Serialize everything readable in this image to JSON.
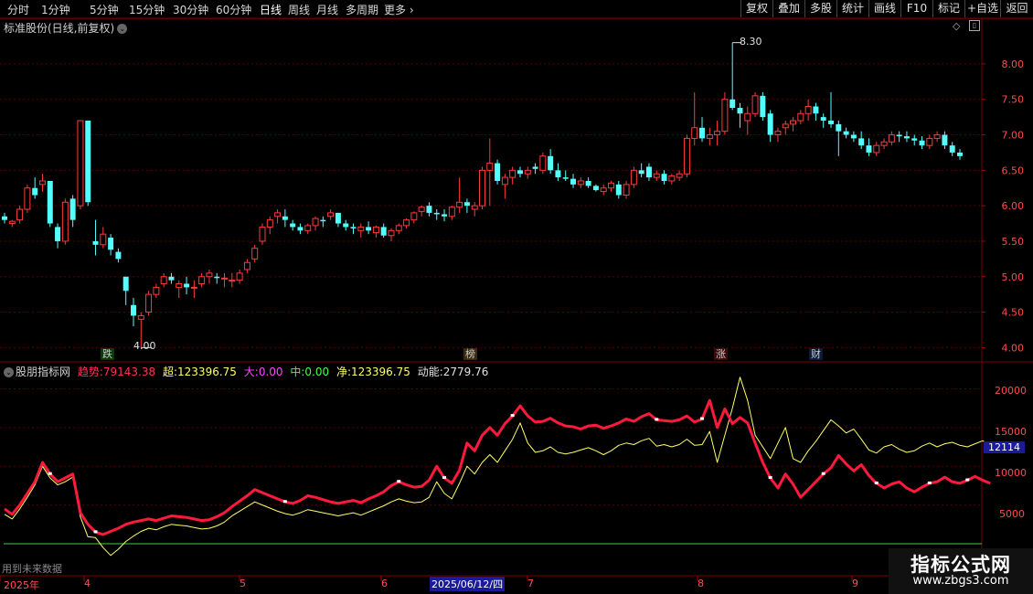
{
  "toolbar": {
    "periods": [
      "分时",
      "1分钟",
      "5分钟",
      "15分钟",
      "30分钟",
      "60分钟",
      "日线",
      "周线",
      "月线",
      "多周期",
      "更多"
    ],
    "active_period": "日线",
    "right_buttons": [
      "复权",
      "叠加",
      "多股",
      "统计",
      "画线",
      "F10",
      "标记",
      "+自选",
      "返回"
    ]
  },
  "main_chart": {
    "title": "标准股份(日线,前复权)",
    "price_axis": [
      "8.00",
      "7.50",
      "7.00",
      "6.50",
      "6.00",
      "5.50",
      "5.00",
      "4.50",
      "4.00"
    ],
    "high_label": "8.30",
    "low_label": "4.00",
    "markers": [
      {
        "text": "跌",
        "color": "#33cc33"
      },
      {
        "text": "榜",
        "color": "#e0a060"
      },
      {
        "text": "涨",
        "color": "#ff4040"
      },
      {
        "text": "财",
        "color": "#4aa8ff"
      }
    ],
    "colors": {
      "up": "#ff3b3b",
      "down": "#54ffff",
      "grid": "#550000"
    }
  },
  "indicator": {
    "name": "股朋指标网",
    "trend_label": "趋势:",
    "trend_value": "79143.38",
    "super_label": "超:",
    "super_value": "123396.75",
    "big_label": "大:",
    "big_value": "0.00",
    "mid_label": "中:",
    "mid_value": "0.00",
    "net_label": "净:",
    "net_value": "123396.75",
    "power_label": "动能:",
    "power_value": "2779.76",
    "axis": [
      "20000",
      "15000",
      "10000",
      "5000"
    ],
    "current_tag": "12114",
    "footer_text": "用到未来数据"
  },
  "time_axis": {
    "labels": [
      "2025年",
      "4",
      "5",
      "6",
      "2025/06/12/四",
      "7",
      "8",
      "9"
    ]
  },
  "watermark": {
    "title": "指标公式网",
    "url": "www.zbgs3.com"
  },
  "chart_data": {
    "type": "candlestick",
    "ohlc": [
      [
        5.85,
        5.9,
        5.75,
        5.8
      ],
      [
        5.75,
        5.8,
        5.7,
        5.78
      ],
      [
        5.8,
        6.0,
        5.75,
        5.95
      ],
      [
        5.95,
        6.3,
        5.9,
        6.25
      ],
      [
        6.25,
        6.4,
        6.1,
        6.15
      ],
      [
        6.3,
        6.45,
        6.2,
        6.35
      ],
      [
        6.35,
        6.35,
        5.7,
        5.75
      ],
      [
        5.7,
        5.75,
        5.4,
        5.5
      ],
      [
        5.5,
        6.1,
        5.45,
        6.05
      ],
      [
        6.1,
        6.15,
        5.7,
        5.8
      ],
      [
        6.0,
        7.2,
        5.95,
        7.2
      ],
      [
        7.2,
        7.2,
        6.0,
        6.05
      ],
      [
        5.5,
        5.8,
        5.3,
        5.45
      ],
      [
        5.45,
        5.7,
        5.4,
        5.6
      ],
      [
        5.55,
        5.6,
        5.3,
        5.38
      ],
      [
        5.35,
        5.4,
        5.2,
        5.25
      ],
      [
        5.0,
        5.0,
        4.6,
        4.8
      ],
      [
        4.6,
        4.7,
        4.3,
        4.45
      ],
      [
        4.4,
        4.5,
        4.0,
        4.45
      ],
      [
        4.5,
        4.8,
        4.45,
        4.75
      ],
      [
        4.75,
        4.9,
        4.7,
        4.85
      ],
      [
        4.9,
        5.05,
        4.85,
        5.0
      ],
      [
        5.0,
        5.05,
        4.9,
        4.95
      ],
      [
        4.85,
        4.95,
        4.7,
        4.9
      ],
      [
        4.9,
        5.0,
        4.75,
        4.85
      ],
      [
        4.85,
        4.95,
        4.7,
        4.85
      ],
      [
        4.9,
        5.05,
        4.85,
        5.0
      ],
      [
        5.0,
        5.1,
        4.9,
        5.05
      ],
      [
        5.0,
        5.05,
        4.9,
        4.98
      ],
      [
        4.98,
        5.05,
        4.85,
        4.98
      ],
      [
        4.95,
        5.05,
        4.85,
        4.95
      ],
      [
        4.95,
        5.1,
        4.9,
        5.05
      ],
      [
        5.1,
        5.25,
        5.05,
        5.2
      ],
      [
        5.25,
        5.45,
        5.2,
        5.4
      ],
      [
        5.5,
        5.75,
        5.45,
        5.7
      ],
      [
        5.7,
        5.85,
        5.6,
        5.8
      ],
      [
        5.85,
        5.95,
        5.75,
        5.9
      ],
      [
        5.85,
        5.95,
        5.7,
        5.8
      ],
      [
        5.75,
        5.8,
        5.65,
        5.7
      ],
      [
        5.7,
        5.75,
        5.6,
        5.65
      ],
      [
        5.65,
        5.75,
        5.6,
        5.72
      ],
      [
        5.72,
        5.85,
        5.65,
        5.82
      ],
      [
        5.8,
        5.85,
        5.7,
        5.78
      ],
      [
        5.85,
        5.95,
        5.8,
        5.9
      ],
      [
        5.9,
        5.9,
        5.7,
        5.75
      ],
      [
        5.75,
        5.8,
        5.65,
        5.7
      ],
      [
        5.7,
        5.75,
        5.6,
        5.68
      ],
      [
        5.65,
        5.75,
        5.55,
        5.7
      ],
      [
        5.7,
        5.78,
        5.6,
        5.65
      ],
      [
        5.62,
        5.72,
        5.55,
        5.7
      ],
      [
        5.7,
        5.75,
        5.55,
        5.58
      ],
      [
        5.58,
        5.68,
        5.5,
        5.65
      ],
      [
        5.65,
        5.75,
        5.6,
        5.72
      ],
      [
        5.72,
        5.82,
        5.68,
        5.8
      ],
      [
        5.8,
        5.92,
        5.75,
        5.9
      ],
      [
        5.92,
        6.0,
        5.85,
        5.98
      ],
      [
        6.0,
        6.05,
        5.85,
        5.9
      ],
      [
        5.9,
        5.95,
        5.8,
        5.88
      ],
      [
        5.88,
        5.95,
        5.78,
        5.85
      ],
      [
        5.85,
        6.0,
        5.8,
        5.98
      ],
      [
        5.98,
        6.4,
        5.9,
        6.05
      ],
      [
        6.05,
        6.1,
        5.9,
        6.0
      ],
      [
        5.95,
        6.05,
        5.85,
        6.0
      ],
      [
        6.0,
        6.55,
        5.95,
        6.5
      ],
      [
        6.5,
        6.95,
        6.0,
        6.6
      ],
      [
        6.6,
        6.65,
        6.3,
        6.35
      ],
      [
        6.3,
        6.45,
        6.1,
        6.4
      ],
      [
        6.4,
        6.55,
        6.3,
        6.5
      ],
      [
        6.5,
        6.55,
        6.4,
        6.45
      ],
      [
        6.45,
        6.55,
        6.38,
        6.5
      ],
      [
        6.55,
        6.6,
        6.45,
        6.52
      ],
      [
        6.5,
        6.75,
        6.45,
        6.7
      ],
      [
        6.7,
        6.8,
        6.45,
        6.5
      ],
      [
        6.5,
        6.6,
        6.35,
        6.4
      ],
      [
        6.4,
        6.5,
        6.35,
        6.38
      ],
      [
        6.38,
        6.45,
        6.25,
        6.3
      ],
      [
        6.3,
        6.4,
        6.25,
        6.35
      ],
      [
        6.35,
        6.4,
        6.25,
        6.28
      ],
      [
        6.28,
        6.3,
        6.2,
        6.22
      ],
      [
        6.2,
        6.3,
        6.15,
        6.25
      ],
      [
        6.25,
        6.35,
        6.2,
        6.32
      ],
      [
        6.3,
        6.35,
        6.1,
        6.15
      ],
      [
        6.15,
        6.35,
        6.1,
        6.3
      ],
      [
        6.3,
        6.55,
        6.25,
        6.5
      ],
      [
        6.5,
        6.6,
        6.4,
        6.45
      ],
      [
        6.55,
        6.6,
        6.35,
        6.4
      ],
      [
        6.4,
        6.5,
        6.35,
        6.45
      ],
      [
        6.45,
        6.5,
        6.3,
        6.35
      ],
      [
        6.35,
        6.45,
        6.3,
        6.42
      ],
      [
        6.4,
        6.5,
        6.35,
        6.45
      ],
      [
        6.45,
        7.0,
        6.4,
        6.95
      ],
      [
        6.95,
        7.6,
        6.85,
        7.1
      ],
      [
        7.1,
        7.25,
        6.9,
        6.95
      ],
      [
        6.95,
        7.1,
        6.85,
        7.0
      ],
      [
        7.0,
        7.2,
        6.85,
        7.05
      ],
      [
        7.05,
        7.6,
        7.0,
        7.5
      ],
      [
        7.5,
        8.3,
        7.35,
        7.38
      ],
      [
        7.38,
        7.45,
        7.1,
        7.3
      ],
      [
        7.2,
        7.4,
        7.0,
        7.3
      ],
      [
        7.3,
        7.6,
        7.25,
        7.55
      ],
      [
        7.55,
        7.6,
        7.2,
        7.25
      ],
      [
        7.3,
        7.35,
        6.9,
        7.0
      ],
      [
        7.0,
        7.1,
        6.9,
        7.05
      ],
      [
        7.1,
        7.2,
        7.0,
        7.15
      ],
      [
        7.15,
        7.25,
        7.05,
        7.2
      ],
      [
        7.2,
        7.35,
        7.15,
        7.3
      ],
      [
        7.3,
        7.5,
        7.2,
        7.4
      ],
      [
        7.4,
        7.45,
        7.2,
        7.3
      ],
      [
        7.25,
        7.3,
        7.1,
        7.2
      ],
      [
        7.2,
        7.6,
        7.1,
        7.15
      ],
      [
        7.15,
        7.2,
        6.7,
        7.05
      ],
      [
        7.05,
        7.1,
        6.95,
        7.0
      ],
      [
        7.0,
        7.05,
        6.9,
        6.95
      ],
      [
        6.95,
        7.05,
        6.8,
        6.85
      ],
      [
        6.85,
        6.95,
        6.7,
        6.75
      ],
      [
        6.75,
        6.9,
        6.7,
        6.85
      ],
      [
        6.85,
        6.95,
        6.8,
        6.9
      ],
      [
        6.9,
        7.05,
        6.85,
        7.0
      ],
      [
        7.0,
        7.05,
        6.9,
        6.98
      ],
      [
        6.98,
        7.05,
        6.9,
        6.95
      ],
      [
        6.95,
        7.0,
        6.85,
        6.92
      ],
      [
        6.92,
        6.98,
        6.8,
        6.85
      ],
      [
        6.85,
        7.0,
        6.8,
        6.95
      ],
      [
        6.95,
        7.05,
        6.9,
        7.0
      ],
      [
        7.0,
        7.05,
        6.8,
        6.85
      ],
      [
        6.85,
        6.9,
        6.7,
        6.75
      ],
      [
        6.75,
        6.8,
        6.65,
        6.7
      ]
    ],
    "price_range": [
      3.85,
      8.45
    ],
    "indicator_series": [
      {
        "name": "趋势",
        "color": "#ff1a3d",
        "values": [
          4500,
          3800,
          5000,
          6500,
          8000,
          10500,
          9000,
          8000,
          8500,
          9000,
          4000,
          2500,
          1500,
          1200,
          1600,
          2000,
          2500,
          2800,
          3000,
          3200,
          3000,
          3300,
          3600,
          3500,
          3400,
          3200,
          3000,
          3100,
          3500,
          4000,
          4800,
          5500,
          6200,
          7000,
          6600,
          6200,
          5800,
          5400,
          5200,
          5600,
          6200,
          6000,
          5700,
          5400,
          5200,
          5400,
          5600,
          5300,
          5800,
          6200,
          6700,
          7500,
          8000,
          7600,
          7300,
          7400,
          8200,
          10000,
          8500,
          7800,
          9500,
          13000,
          12000,
          14000,
          15000,
          14000,
          15500,
          16500,
          17800,
          16500,
          15700,
          15800,
          16200,
          15600,
          15200,
          15100,
          14800,
          15200,
          15300,
          14900,
          15200,
          15600,
          16100,
          15800,
          16400,
          16800,
          16000,
          15900,
          15800,
          16000,
          16500,
          15700,
          16100,
          18500,
          15000,
          17400,
          15500,
          16300,
          15600,
          13000,
          10500,
          8500,
          7200,
          9000,
          7700,
          6000,
          7000,
          8000,
          9000,
          9800,
          11400,
          10300,
          9400,
          10200,
          8800,
          7800,
          7200,
          7700,
          8000,
          7200,
          6700,
          7300,
          7800,
          8000,
          8600,
          8000,
          7800,
          8200,
          8700,
          8200,
          7800
        ]
      },
      {
        "name": "超",
        "color": "#ffff66",
        "values": [
          3800,
          3200,
          4500,
          6000,
          7600,
          10000,
          8500,
          7600,
          8000,
          8600,
          3500,
          900,
          800,
          -500,
          -1500,
          -700,
          300,
          1000,
          1600,
          2000,
          1800,
          2200,
          2500,
          2400,
          2300,
          2100,
          1900,
          2000,
          2300,
          2800,
          3600,
          4200,
          4800,
          5400,
          5000,
          4600,
          4200,
          3900,
          3700,
          4000,
          4400,
          4200,
          4000,
          3800,
          3600,
          3800,
          4000,
          3700,
          4100,
          4500,
          4900,
          5400,
          5800,
          5500,
          5300,
          5400,
          6000,
          8000,
          6500,
          5800,
          7800,
          10000,
          9000,
          10500,
          11500,
          10500,
          12000,
          13500,
          15600,
          13000,
          11800,
          12000,
          12500,
          11800,
          11600,
          11800,
          12100,
          12400,
          12000,
          11500,
          12000,
          12700,
          13000,
          12800,
          13300,
          13600,
          12600,
          12800,
          12500,
          12800,
          13500,
          12700,
          12800,
          14500,
          10500,
          14000,
          17500,
          21500,
          18500,
          14000,
          12500,
          11000,
          13000,
          15000,
          11000,
          10500,
          12000,
          13200,
          14600,
          16000,
          15200,
          14300,
          14800,
          13500,
          12100,
          11700,
          12500,
          12800,
          12200,
          11800,
          12000,
          12600,
          13000,
          12500,
          12900,
          13100,
          12700,
          12500,
          12900,
          13300,
          12700,
          12114
        ]
      }
    ],
    "indicator_range": [
      -2000,
      23000
    ],
    "zero_line": 0
  }
}
